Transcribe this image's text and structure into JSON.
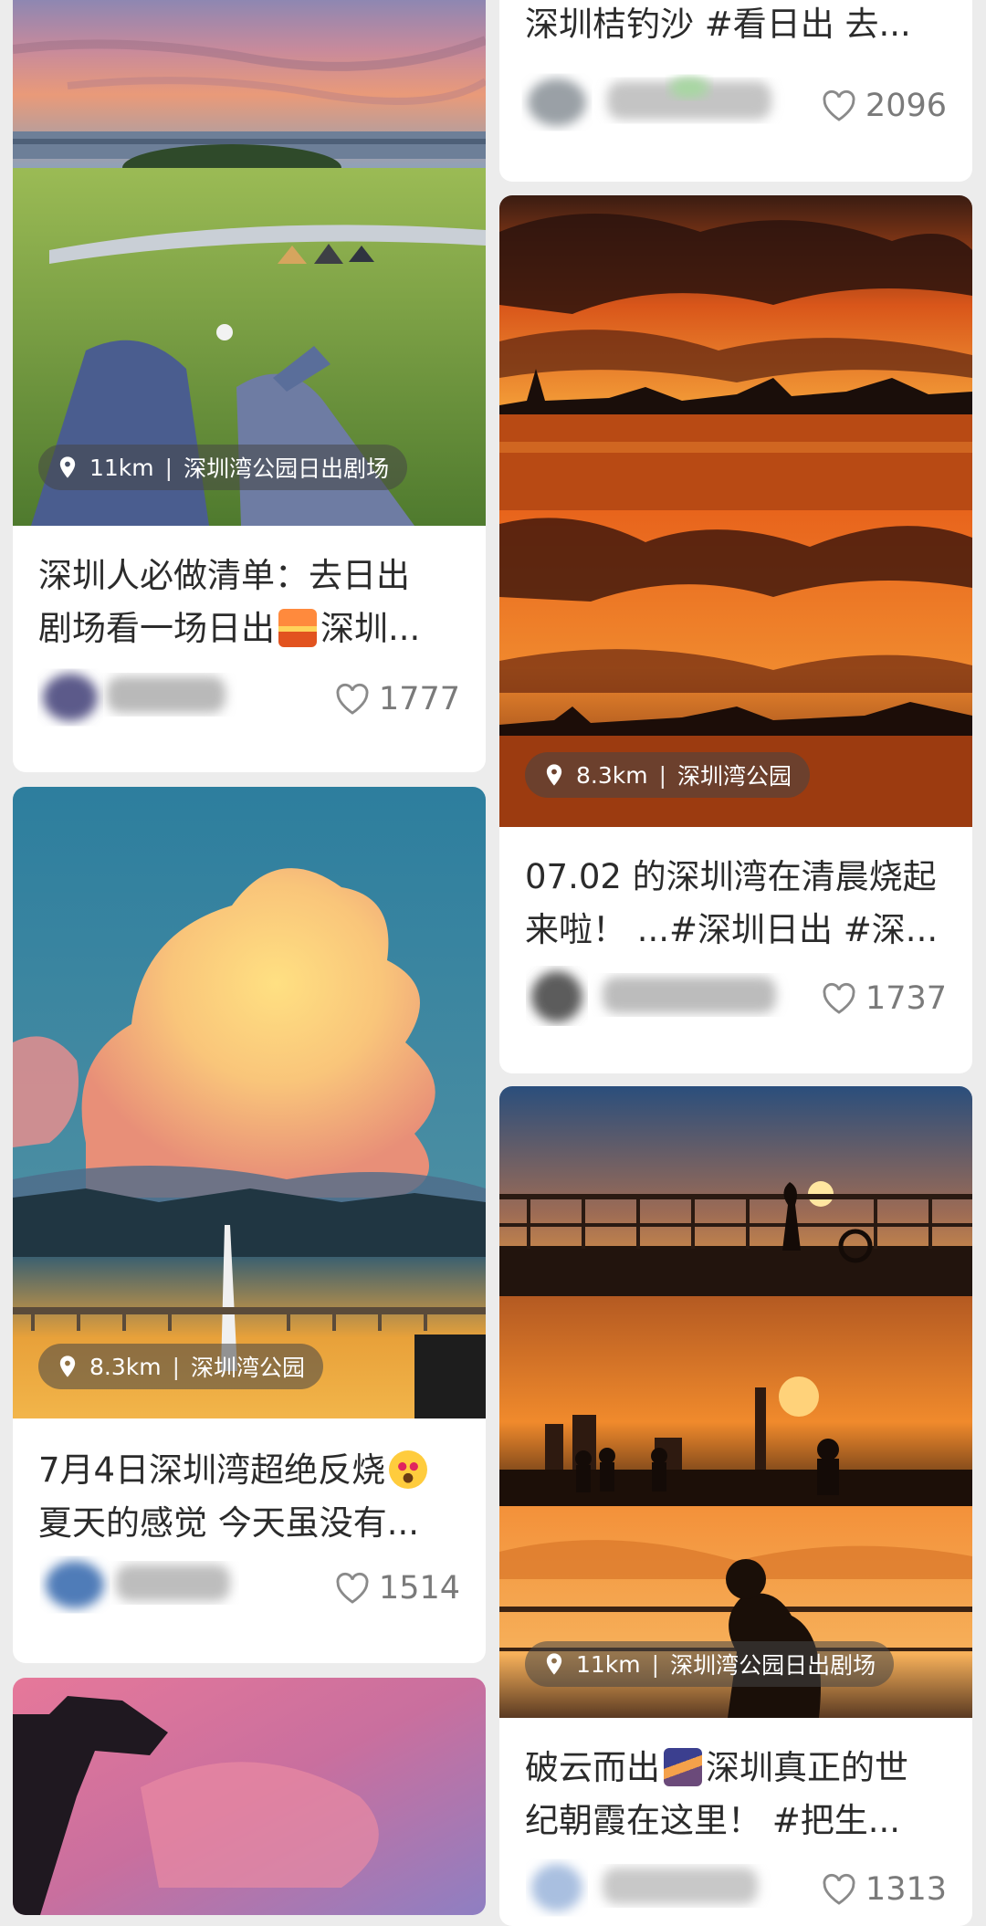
{
  "colors": {
    "background": "#ececec",
    "card": "#ffffff",
    "text": "#2b2b2b",
    "muted": "#7a7a7a",
    "location_pill": "rgba(70,70,70,0.55)"
  },
  "left_column": [
    {
      "location_distance": "11km",
      "location_name": "深圳湾公园日出剧场",
      "title_line1": "深圳人必做清单：去日出",
      "title_line2_pre": "剧场看一场日出",
      "title_emoji": "sunrise-emoji",
      "title_line2_post": "深圳...",
      "likes": "1777"
    },
    {
      "location_distance": "8.3km",
      "location_name": "深圳湾公园",
      "title_line1_pre": "7月4日深圳湾超绝反烧",
      "title_emoji": "heart-eyes-emoji",
      "title_line2": "夏天的感觉 今天虽没有...",
      "likes": "1514"
    }
  ],
  "right_column": [
    {
      "title_line1": "深圳桔钓沙 #看日出 去...",
      "likes": "2096"
    },
    {
      "location_distance": "8.3km",
      "location_name": "深圳湾公园",
      "title_line1": "07.02 的深圳湾在清晨烧起",
      "title_line2": "来啦！ ...#深圳日出 #深...",
      "likes": "1737"
    },
    {
      "location_distance": "11km",
      "location_name": "深圳湾公园日出剧场",
      "title_line1_pre": "破云而出",
      "title_emoji": "sunrise-over-mountains-emoji",
      "title_line1_post": "深圳真正的世",
      "title_line2": "纪朝霞在这里！ #把生...",
      "likes": "1313"
    }
  ],
  "icons": {
    "location": "location-pin-icon",
    "like": "heart-outline-icon"
  }
}
